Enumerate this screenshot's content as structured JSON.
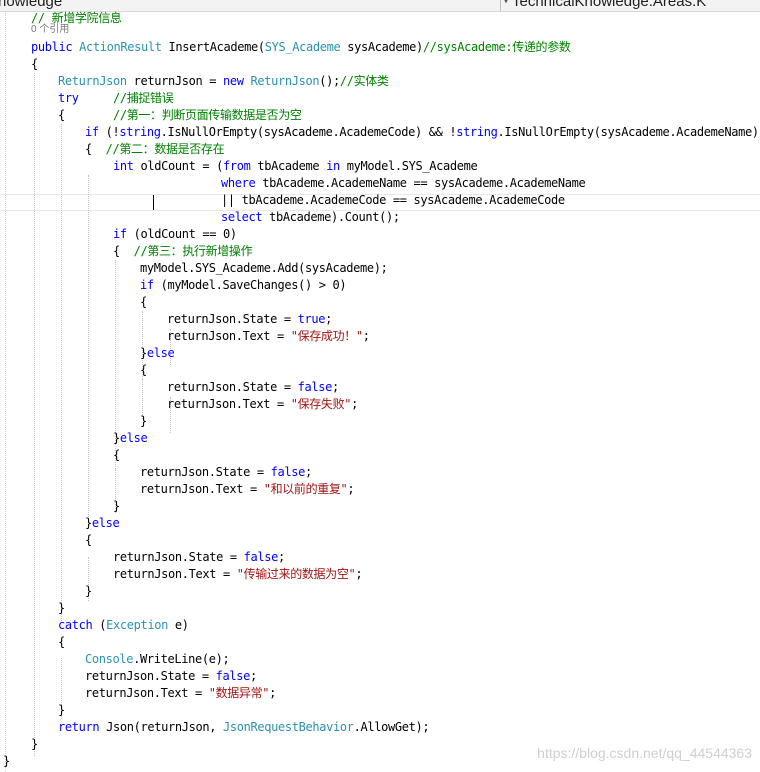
{
  "tabs": {
    "left_label": "nowledge",
    "right_label": "TechnicalKnowledge.Areas.K"
  },
  "code": {
    "lines": [
      [
        {
          "t": "// 新增学院信息",
          "c": "cm"
        }
      ],
      [
        {
          "t": "0 个引用",
          "c": "lens"
        }
      ],
      [
        {
          "t": "public",
          "c": "kw"
        },
        {
          "t": " ",
          "c": "pl"
        },
        {
          "t": "ActionResult",
          "c": "type"
        },
        {
          "t": " InsertAcademe(",
          "c": "pl"
        },
        {
          "t": "SYS_Academe",
          "c": "type"
        },
        {
          "t": " sysAcademe)",
          "c": "pl"
        },
        {
          "t": "//sysAcademe:传递的参数",
          "c": "cm"
        }
      ],
      [
        {
          "t": "{",
          "c": "pl"
        }
      ],
      [
        {
          "t": "ReturnJson",
          "c": "type"
        },
        {
          "t": " returnJson = ",
          "c": "pl"
        },
        {
          "t": "new",
          "c": "kw"
        },
        {
          "t": " ",
          "c": "pl"
        },
        {
          "t": "ReturnJson",
          "c": "type"
        },
        {
          "t": "();",
          "c": "pl"
        },
        {
          "t": "//实体类",
          "c": "cm"
        }
      ],
      [
        {
          "t": "try",
          "c": "kw"
        },
        {
          "t": "     ",
          "c": "pl"
        },
        {
          "t": "//捕捉错误",
          "c": "cm"
        }
      ],
      [
        {
          "t": "{",
          "c": "pl"
        },
        {
          "t": "       ",
          "c": "pl"
        },
        {
          "t": "//第一：判断页面传输数据是否为空",
          "c": "cm"
        }
      ],
      [
        {
          "t": "if",
          "c": "kw"
        },
        {
          "t": " (!",
          "c": "pl"
        },
        {
          "t": "string",
          "c": "kw"
        },
        {
          "t": ".IsNullOrEmpty(sysAcademe.AcademeCode) && !",
          "c": "pl"
        },
        {
          "t": "string",
          "c": "kw"
        },
        {
          "t": ".IsNullOrEmpty(sysAcademe.AcademeName))",
          "c": "pl"
        }
      ],
      [
        {
          "t": "{",
          "c": "pl"
        },
        {
          "t": "  ",
          "c": "pl"
        },
        {
          "t": "//第二：数据是否存在",
          "c": "cm"
        }
      ],
      [
        {
          "t": "int",
          "c": "kw"
        },
        {
          "t": " oldCount = (",
          "c": "pl"
        },
        {
          "t": "from",
          "c": "kw"
        },
        {
          "t": " tbAcademe ",
          "c": "pl"
        },
        {
          "t": "in",
          "c": "kw"
        },
        {
          "t": " myModel.SYS_Academe",
          "c": "pl"
        }
      ],
      [
        {
          "t": "where",
          "c": "kw"
        },
        {
          "t": " tbAcademe.AcademeName == sysAcademe.AcademeName",
          "c": "pl"
        }
      ],
      [
        {
          "t": "|| tbAcademe.AcademeCode == sysAcademe.AcademeCode",
          "c": "pl"
        }
      ],
      [
        {
          "t": "select",
          "c": "kw"
        },
        {
          "t": " tbAcademe).Count();",
          "c": "pl"
        }
      ],
      [
        {
          "t": "if",
          "c": "kw"
        },
        {
          "t": " (oldCount == 0)",
          "c": "pl"
        }
      ],
      [
        {
          "t": "{",
          "c": "pl"
        },
        {
          "t": "  ",
          "c": "pl"
        },
        {
          "t": "//第三：执行新增操作",
          "c": "cm"
        }
      ],
      [
        {
          "t": "myModel.SYS_Academe.Add(sysAcademe);",
          "c": "pl"
        }
      ],
      [
        {
          "t": "if",
          "c": "kw"
        },
        {
          "t": " (myModel.SaveChanges() > 0)",
          "c": "pl"
        }
      ],
      [
        {
          "t": "{",
          "c": "pl"
        }
      ],
      [
        {
          "t": "returnJson.State = ",
          "c": "pl"
        },
        {
          "t": "true",
          "c": "kw"
        },
        {
          "t": ";",
          "c": "pl"
        }
      ],
      [
        {
          "t": "returnJson.Text = ",
          "c": "pl"
        },
        {
          "t": "\"保存成功！\"",
          "c": "str"
        },
        {
          "t": ";",
          "c": "pl"
        }
      ],
      [
        {
          "t": "}",
          "c": "pl"
        },
        {
          "t": "else",
          "c": "kw"
        }
      ],
      [
        {
          "t": "{",
          "c": "pl"
        }
      ],
      [
        {
          "t": "returnJson.State = ",
          "c": "pl"
        },
        {
          "t": "false",
          "c": "kw"
        },
        {
          "t": ";",
          "c": "pl"
        }
      ],
      [
        {
          "t": "returnJson.Text = ",
          "c": "pl"
        },
        {
          "t": "\"保存失败\"",
          "c": "str"
        },
        {
          "t": ";",
          "c": "pl"
        }
      ],
      [
        {
          "t": "}",
          "c": "pl"
        }
      ],
      [
        {
          "t": "}",
          "c": "pl"
        },
        {
          "t": "else",
          "c": "kw"
        }
      ],
      [
        {
          "t": "{",
          "c": "pl"
        }
      ],
      [
        {
          "t": "returnJson.State = ",
          "c": "pl"
        },
        {
          "t": "false",
          "c": "kw"
        },
        {
          "t": ";",
          "c": "pl"
        }
      ],
      [
        {
          "t": "returnJson.Text = ",
          "c": "pl"
        },
        {
          "t": "\"和以前的重复\"",
          "c": "str"
        },
        {
          "t": ";",
          "c": "pl"
        }
      ],
      [
        {
          "t": "}",
          "c": "pl"
        }
      ],
      [
        {
          "t": "}",
          "c": "pl"
        },
        {
          "t": "else",
          "c": "kw"
        }
      ],
      [
        {
          "t": "{",
          "c": "pl"
        }
      ],
      [
        {
          "t": "returnJson.State = ",
          "c": "pl"
        },
        {
          "t": "false",
          "c": "kw"
        },
        {
          "t": ";",
          "c": "pl"
        }
      ],
      [
        {
          "t": "returnJson.Text = ",
          "c": "pl"
        },
        {
          "t": "\"传输过来的数据为空\"",
          "c": "str"
        },
        {
          "t": ";",
          "c": "pl"
        }
      ],
      [
        {
          "t": "}",
          "c": "pl"
        }
      ],
      [
        {
          "t": "}",
          "c": "pl"
        }
      ],
      [
        {
          "t": "catch",
          "c": "kw"
        },
        {
          "t": " (",
          "c": "pl"
        },
        {
          "t": "Exception",
          "c": "type"
        },
        {
          "t": " e)",
          "c": "pl"
        }
      ],
      [
        {
          "t": "{",
          "c": "pl"
        }
      ],
      [
        {
          "t": "Console",
          "c": "type"
        },
        {
          "t": ".WriteLine(e);",
          "c": "pl"
        }
      ],
      [
        {
          "t": "returnJson.State = ",
          "c": "pl"
        },
        {
          "t": "false",
          "c": "kw"
        },
        {
          "t": ";",
          "c": "pl"
        }
      ],
      [
        {
          "t": "returnJson.Text = ",
          "c": "pl"
        },
        {
          "t": "\"数据异常\"",
          "c": "str"
        },
        {
          "t": ";",
          "c": "pl"
        }
      ],
      [
        {
          "t": "}",
          "c": "pl"
        }
      ],
      [
        {
          "t": "return",
          "c": "kw"
        },
        {
          "t": " Json(returnJson, ",
          "c": "pl"
        },
        {
          "t": "JsonRequestBehavior",
          "c": "type"
        },
        {
          "t": ".AllowGet);",
          "c": "pl"
        }
      ],
      [
        {
          "t": "}",
          "c": "pl"
        }
      ],
      [
        {
          "t": "}",
          "c": "pl"
        }
      ]
    ]
  },
  "watermark": "https://blog.csdn.net/qq_44544363",
  "colors": {
    "keyword": "#0000ff",
    "type": "#2b91af",
    "string": "#a31515",
    "comment": "#008000"
  }
}
